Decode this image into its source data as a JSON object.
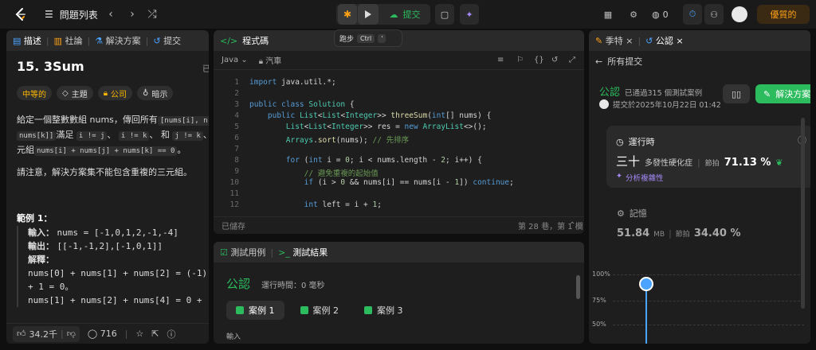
{
  "topbar": {
    "problem_list": "問題列表",
    "submit": "提交",
    "coins": "0",
    "premium": "優質的"
  },
  "tooltip": {
    "label": "跑步",
    "key1": "Ctrl",
    "key2": "'"
  },
  "left": {
    "tabs": [
      "描述",
      "社論",
      "解決方案",
      "提交"
    ],
    "title": "15. 3Sum",
    "already": "已",
    "badges": [
      "中等的",
      "主題",
      "公司",
      "暗示"
    ],
    "desc_line1": "給定一個整數數組 nums，傳回所有",
    "desc_code1": "[nums[i], n",
    "desc_code2": "nums[k]]",
    "desc_line2": "滿足",
    "desc_code3": "i != j",
    "desc_line2b": "、",
    "desc_code4": "i != k",
    "desc_line2c": "、 和",
    "desc_code5": "j != k",
    "desc_line2d": "、 ·",
    "desc_line3": "元組",
    "desc_code6": "nums[i] + nums[j] + nums[k] == 0",
    "desc_line3b": "。",
    "note": "請注意，解決方案集不能包含重複的三元組。",
    "example_title": "範例 1：",
    "ex_input_label": "輸入：",
    "ex_input": "nums = [-1,0,1,2,-1,-4]",
    "ex_output_label": "輸出：",
    "ex_output": "[[-1,-1,2],[-1,0,1]]",
    "ex_expl_label": "解釋：",
    "ex_expl1": "nums[0] + nums[1] + nums[2] = (-1)",
    "ex_expl2": "+ 1 = 0。",
    "ex_expl3": "nums[1] + nums[2] + nums[4] = 0 +",
    "likes": "34.2千",
    "comments": "716"
  },
  "editor": {
    "header": "程式碼",
    "language": "Java",
    "mode": "汽車",
    "status_left": "已儲存",
    "status_right": "第 28 巷，第 1 欄",
    "lines": [
      "import java.util.*;",
      "",
      "public class Solution {",
      "    public List<List<Integer>> threeSum(int[] nums) {",
      "        List<List<Integer>> res = new ArrayList<>();",
      "        Arrays.sort(nums); // 先排序",
      "",
      "        for (int i = 0; i < nums.length - 2; i++) {",
      "            // 避免重複的起始值",
      "            if (i > 0 && nums[i] == nums[i - 1]) continue;",
      "",
      "            int left = i + 1;"
    ]
  },
  "tests": {
    "tab1": "測試用例",
    "tab2": "測試結果",
    "accepted": "公認",
    "runtime": "運行時間：0 毫秒",
    "cases": [
      "案例 1",
      "案例 2",
      "案例 3"
    ],
    "input_label": "輸入"
  },
  "right": {
    "tab1": "季特",
    "tab2": "公認",
    "back": "所有提交",
    "accepted": "公認",
    "passed": "已通過315 個測試案例",
    "submitted": "提交於2025年10月22日 01:42",
    "solution_btn": "解決方案",
    "runtime_title": "運行時",
    "runtime_value": "三十",
    "runtime_desc": "多發性硬化症",
    "beats_label": "節拍",
    "runtime_beats": "71.13 %",
    "analyze": "分析複雜性",
    "memory_title": "記憶",
    "memory_value": "51.84",
    "memory_unit": "MB",
    "memory_beats": "34.40 %",
    "chart_ticks": [
      "100%",
      "75%",
      "50%"
    ]
  }
}
